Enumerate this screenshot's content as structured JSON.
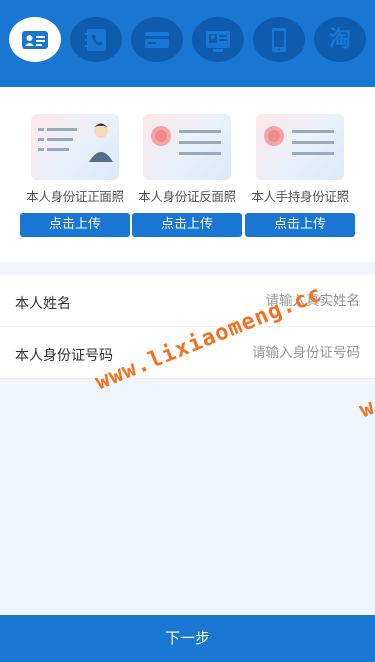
{
  "tabs": [
    {
      "icon": "id-card-icon",
      "active": true
    },
    {
      "icon": "phone-book-icon",
      "active": false
    },
    {
      "icon": "bank-card-icon",
      "active": false
    },
    {
      "icon": "certificate-icon",
      "active": false
    },
    {
      "icon": "mobile-phone-icon",
      "active": false
    },
    {
      "icon": "taobao-icon",
      "glyph": "淘",
      "active": false
    }
  ],
  "uploads": [
    {
      "label": "本人身份证正面照",
      "button": "点击上传"
    },
    {
      "label": "本人身份证反面照",
      "button": "点击上传"
    },
    {
      "label": "本人手持身份证照",
      "button": "点击上传"
    }
  ],
  "form": {
    "name_label": "本人姓名",
    "name_placeholder": "请输入真实姓名",
    "id_label": "本人身份证号码",
    "id_placeholder": "请输入身份证号码"
  },
  "watermark": "www.lixiaomeng.cc",
  "watermark_fragment": "w",
  "next_button": "下一步",
  "colors": {
    "primary": "#1976d2",
    "tab_bg": "#0f5cae",
    "watermark": "#f5711e"
  }
}
